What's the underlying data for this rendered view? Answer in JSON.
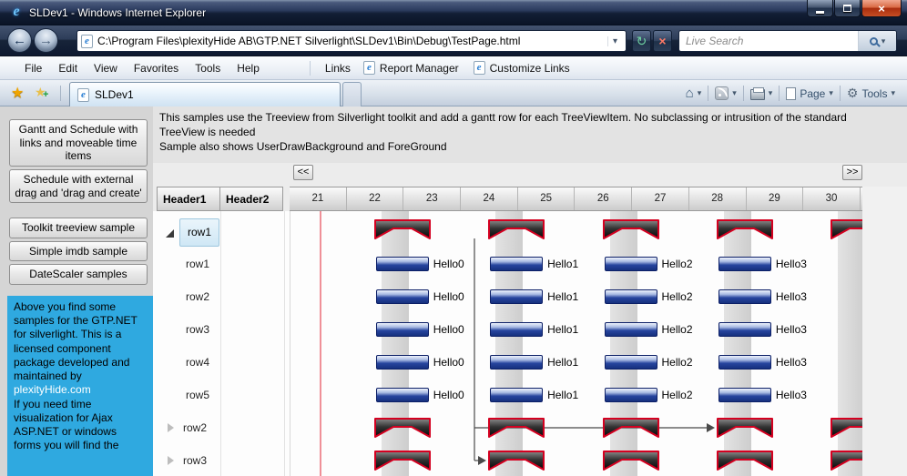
{
  "window": {
    "title": "SLDev1 - Windows Internet Explorer"
  },
  "nav": {
    "address": "C:\\Program Files\\plexityHide AB\\GTP.NET Silverlight\\SLDev1\\Bin\\Debug\\TestPage.html",
    "search_placeholder": "Live Search"
  },
  "menubar": {
    "items": [
      "File",
      "Edit",
      "View",
      "Favorites",
      "Tools",
      "Help"
    ],
    "links_label": "Links",
    "link_items": [
      "Report Manager",
      "Customize Links"
    ]
  },
  "tabbar": {
    "active_tab": "SLDev1",
    "page_label": "Page",
    "tools_label": "Tools"
  },
  "app": {
    "sidebar": {
      "buttons": [
        "Gantt and Schedule with links and moveable time items",
        "Schedule with external drag and 'drag and create'",
        "Toolkit treeview sample",
        "Simple imdb sample",
        "DateScaler samples"
      ],
      "info_text_1": "Above you find some samples for the GTP.NET for silverlight. This is a licensed component package developed and maintained by",
      "info_link": "plexityHide.com",
      "info_text_2": "If you need time visualization for Ajax ASP.NET or windows forms you will find the"
    },
    "description_lines": [
      "This samples use the Treeview from Silverlight toolkit and add a gantt row for each TreeViewItem. No subclassing or intrusition of the standard",
      "TreeView is needed",
      "Sample also shows UserDrawBackground and ForeGround"
    ],
    "pager_left": "<<",
    "pager_right": ">>",
    "grid": {
      "headers": [
        "Header1",
        "Header2"
      ],
      "days": [
        "21",
        "22",
        "23",
        "24",
        "25",
        "26",
        "27",
        "28",
        "29",
        "30"
      ],
      "root_row": "row1",
      "child_rows": [
        "row1",
        "row2",
        "row3",
        "row4",
        "row5"
      ],
      "collapsed_rows": [
        "row2",
        "row3"
      ],
      "task_labels": [
        "Hello0",
        "Hello1",
        "Hello2",
        "Hello3"
      ]
    }
  },
  "icons": {
    "ie_e": "e",
    "close": "×",
    "back": "←",
    "forward": "→",
    "refresh": "↻",
    "stop": "×",
    "dropdown": "▾",
    "star": "★",
    "plus": "+",
    "home": "⌂",
    "gear": "⚙"
  }
}
